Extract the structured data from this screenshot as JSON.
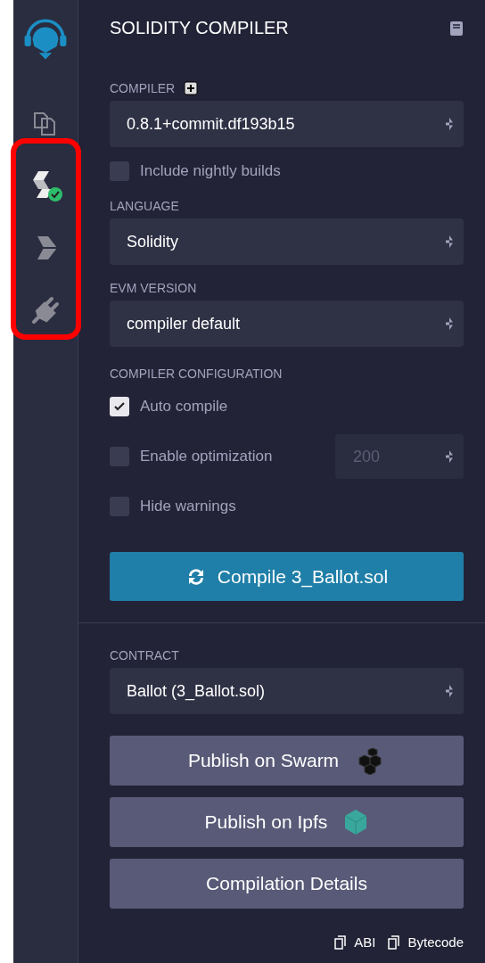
{
  "sidebar": {
    "items": [
      {
        "kind": "logo"
      },
      {
        "kind": "files",
        "selected": false
      },
      {
        "kind": "compiler",
        "selected": true
      },
      {
        "kind": "deploy",
        "selected": false
      },
      {
        "kind": "plugins",
        "selected": false
      }
    ]
  },
  "panel": {
    "title": "SOLIDITY COMPILER",
    "compiler": {
      "label": "COMPILER",
      "value": "0.8.1+commit.df193b15"
    },
    "nightly": {
      "label": "Include nightly builds",
      "checked": false
    },
    "language": {
      "label": "LANGUAGE",
      "value": "Solidity"
    },
    "evm": {
      "label": "EVM VERSION",
      "value": "compiler default"
    },
    "config": {
      "label": "COMPILER CONFIGURATION",
      "options": [
        {
          "label": "Auto compile",
          "checked": true
        },
        {
          "label": "Enable optimization",
          "checked": false,
          "runs": "200"
        },
        {
          "label": "Hide warnings",
          "checked": false
        }
      ]
    },
    "compile_button": "Compile 3_Ballot.sol",
    "contract": {
      "label": "CONTRACT",
      "value": "Ballot (3_Ballot.sol)"
    },
    "actions": [
      {
        "label": "Publish on Swarm",
        "kind": "swarm"
      },
      {
        "label": "Publish on Ipfs",
        "kind": "ipfs"
      },
      {
        "label": "Compilation Details",
        "kind": "details"
      }
    ],
    "copy_links": [
      "ABI",
      "Bytecode"
    ]
  }
}
